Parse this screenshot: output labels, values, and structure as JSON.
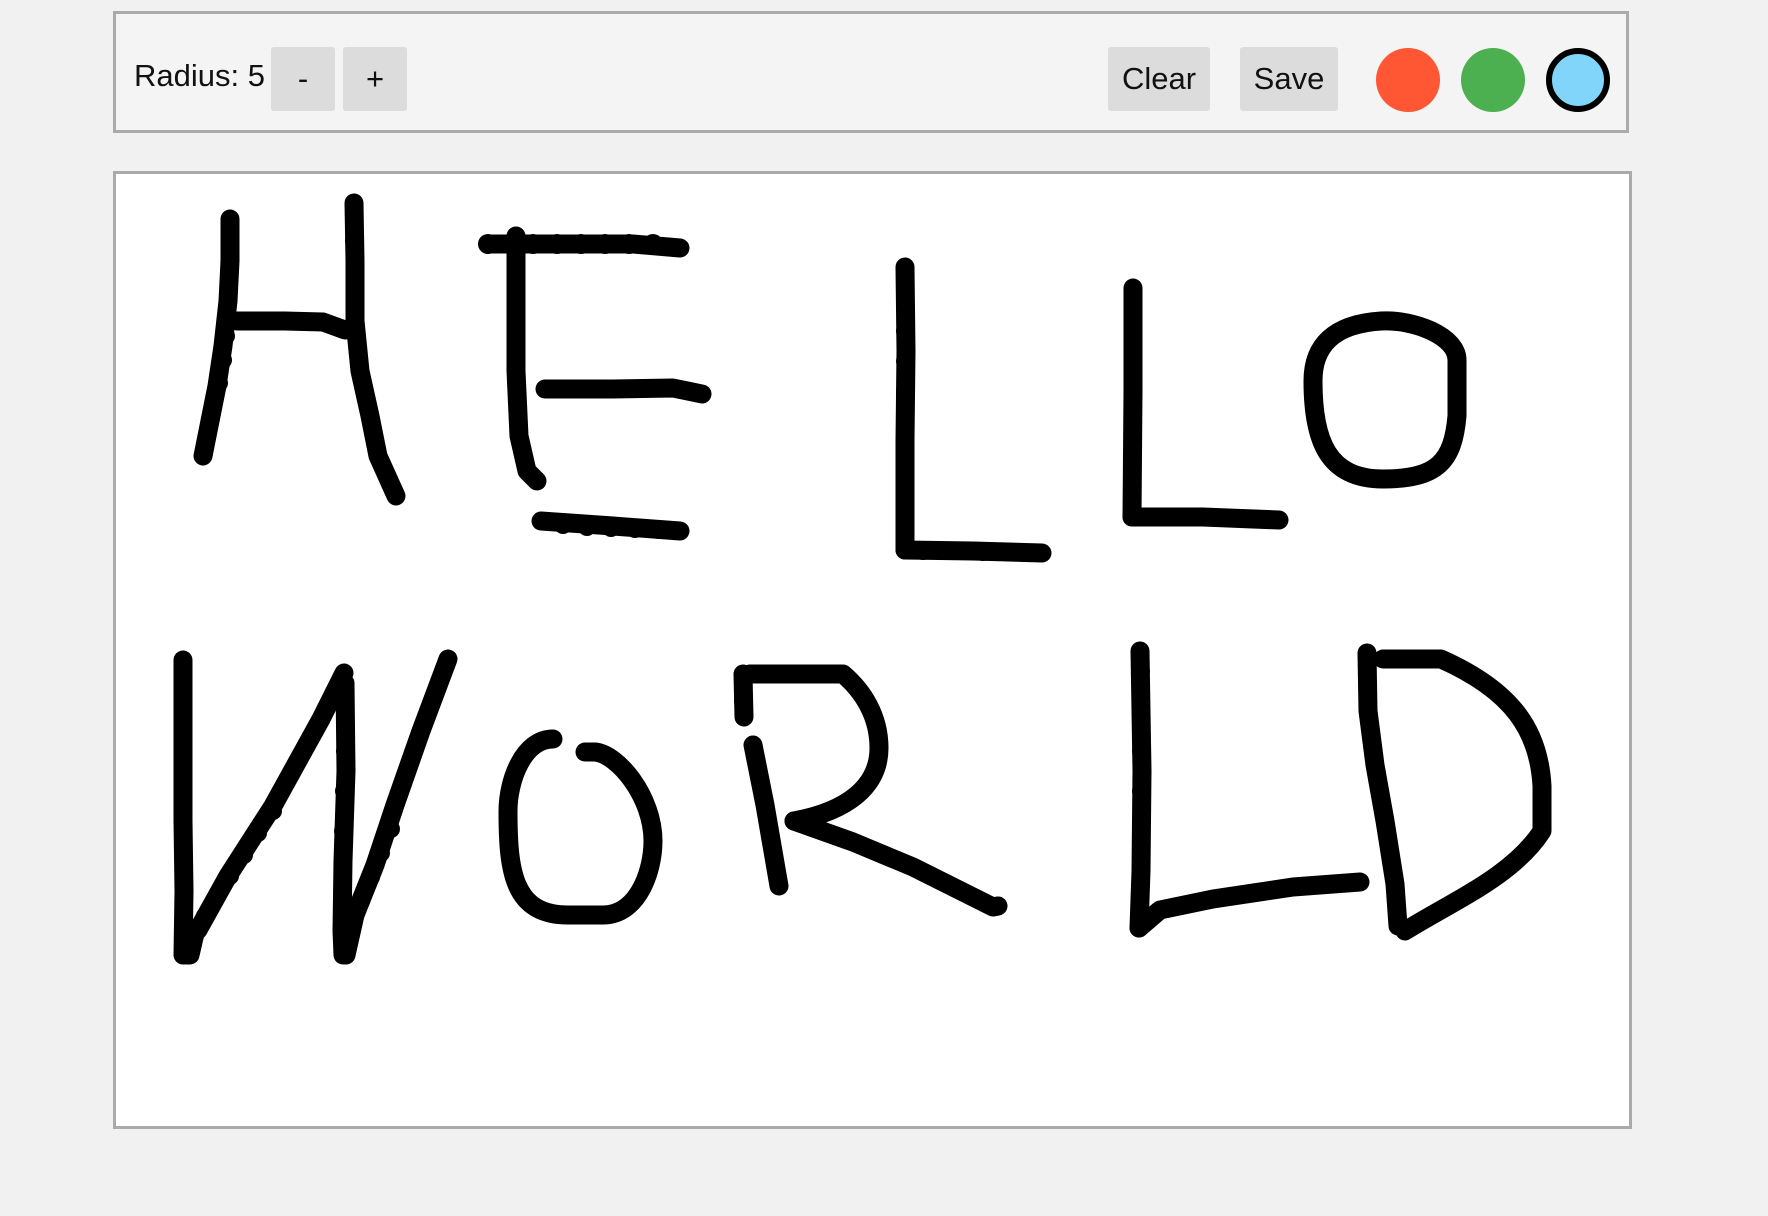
{
  "toolbar": {
    "radius_label": "Radius:",
    "radius_value": "5",
    "minus_label": "-",
    "plus_label": "+",
    "clear_label": "Clear",
    "save_label": "Save"
  },
  "colors": {
    "page_background": "#f1f1f1",
    "toolbar_background": "#f4f4f4",
    "border": "#aaaaaa",
    "button": "#dcdcdc",
    "brush": "#000000"
  },
  "swatches": [
    {
      "name": "orange",
      "color": "#ff5733",
      "selected": false
    },
    {
      "name": "green",
      "color": "#4caf50",
      "selected": false
    },
    {
      "name": "light-blue",
      "color": "#81d4fa",
      "selected": true
    }
  ],
  "drawing": {
    "handwritten_text": "HELLO WORLD",
    "stroke_color": "#000000",
    "brush_radius": 5
  }
}
